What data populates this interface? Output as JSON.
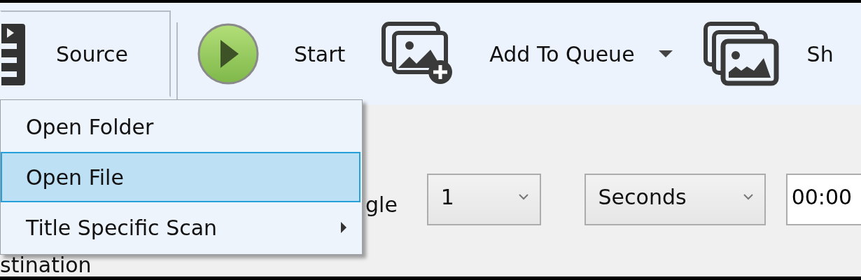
{
  "toolbar": {
    "items": [
      {
        "kind": "source",
        "label": "Source",
        "pressed": true
      },
      {
        "kind": "start",
        "label": "Start",
        "pressed": false
      },
      {
        "kind": "queue_add",
        "label": "Add To Queue",
        "pressed": false,
        "dropdown": true
      },
      {
        "kind": "queue_show",
        "label": "Sh",
        "pressed": false
      }
    ]
  },
  "source_menu": {
    "items": [
      {
        "label": "Open Folder",
        "selected": false,
        "has_submenu": false
      },
      {
        "label": "Open File",
        "selected": true,
        "has_submenu": false
      },
      {
        "label": "Title Specific Scan",
        "selected": false,
        "has_submenu": true
      }
    ]
  },
  "range_row": {
    "label": "gle",
    "start": "1",
    "unit": "Seconds",
    "time": "00:00"
  },
  "destination_label": "stination"
}
